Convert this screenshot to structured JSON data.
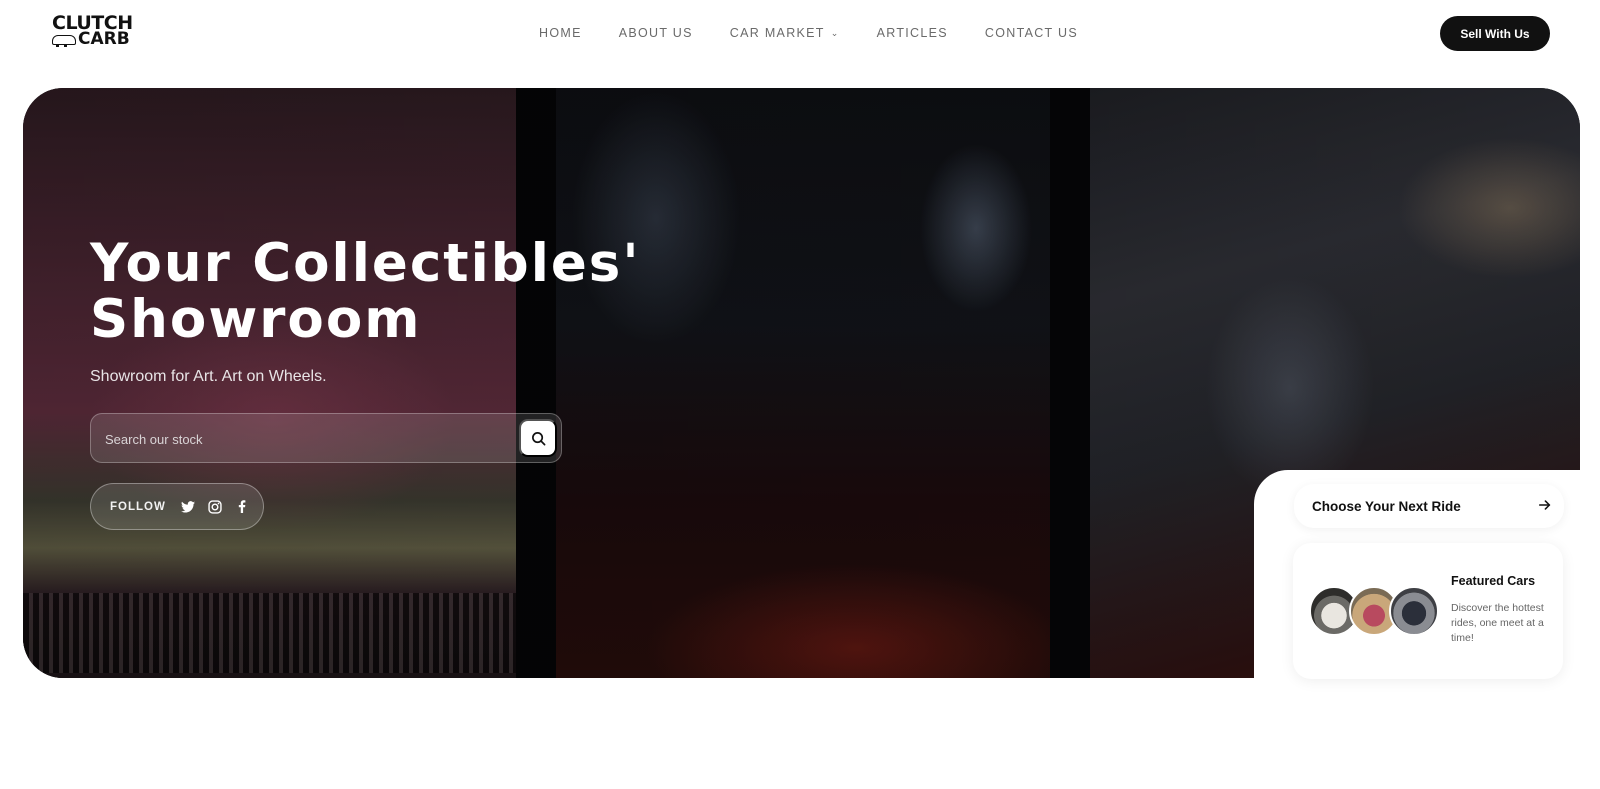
{
  "logo": {
    "line1": "CLUTCH",
    "line2": "CARB"
  },
  "nav": {
    "items": [
      {
        "label": "HOME"
      },
      {
        "label": "ABOUT US"
      },
      {
        "label": "CAR MARKET",
        "has_dropdown": true,
        "chevron": "⌄"
      },
      {
        "label": "ARTICLES"
      },
      {
        "label": "CONTACT US"
      }
    ]
  },
  "header": {
    "cta_label": "Sell With Us"
  },
  "hero": {
    "title_line1": "Your Collectibles'",
    "title_line2": "Showroom",
    "subtitle": "Showroom for Art. Art on Wheels.",
    "search": {
      "placeholder": "Search our stock",
      "value": "",
      "icon": "search-icon"
    },
    "follow": {
      "label": "FOLLOW",
      "icons": [
        "twitter-icon",
        "instagram-icon",
        "facebook-icon"
      ]
    }
  },
  "cards": {
    "choose": {
      "label": "Choose Your Next Ride",
      "icon": "arrow-right-icon"
    },
    "featured": {
      "title": "Featured Cars",
      "description": "Discover the hottest rides, one meet at a time!"
    }
  },
  "colors": {
    "primary": "#111111",
    "nav_text": "#6a6a6a",
    "background": "#ffffff"
  }
}
